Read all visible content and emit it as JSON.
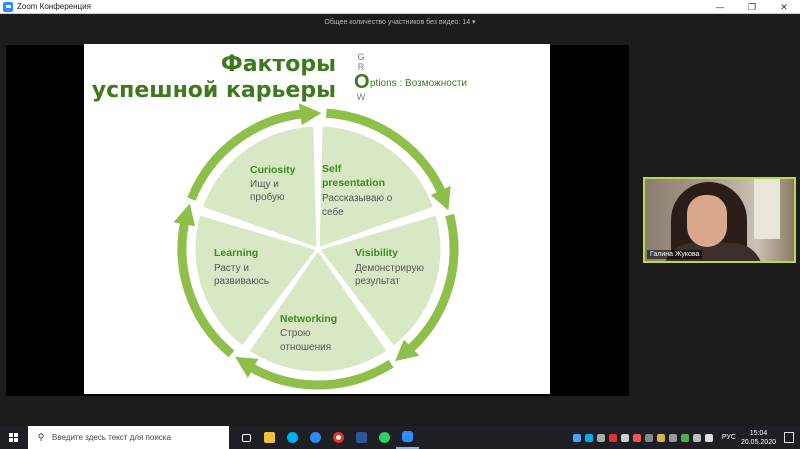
{
  "window": {
    "title": "Zoom Конференция",
    "minimize": "—",
    "maximize": "❐",
    "close": "✕"
  },
  "meeting": {
    "participants_text": "Общее количество участников без видео: 14 ▾"
  },
  "slide": {
    "title_line1": "Факторы",
    "title_line2": "успешной карьеры",
    "grow": {
      "g": "G",
      "r": "R",
      "o": "O",
      "w": "W",
      "caption": "ptions : Возможности"
    },
    "segments": [
      {
        "title": "Curiosity",
        "body1": "Ищу и",
        "body2": "пробую"
      },
      {
        "title": "Self",
        "title2": "presentation",
        "body1": "Рассказываю о",
        "body2": "себе"
      },
      {
        "title": "Visibility",
        "body1": "Демонстрирую",
        "body2": "результат"
      },
      {
        "title": "Networking",
        "body1": "Строю",
        "body2": "отношения"
      },
      {
        "title": "Learning",
        "body1": "Расту и",
        "body2": "развиваюсь"
      }
    ]
  },
  "video": {
    "name": "Галина Жукова"
  },
  "taskbar": {
    "search_placeholder": "Введите здесь текст для поиска",
    "lang": "РУС",
    "time": "15:04",
    "date": "20.05.2020"
  },
  "colors": {
    "accent": "#3d7a1e",
    "ring": "#8ebf4a",
    "segment_fill": "#d8e8c4",
    "speaker_border": "#b9d84b"
  }
}
